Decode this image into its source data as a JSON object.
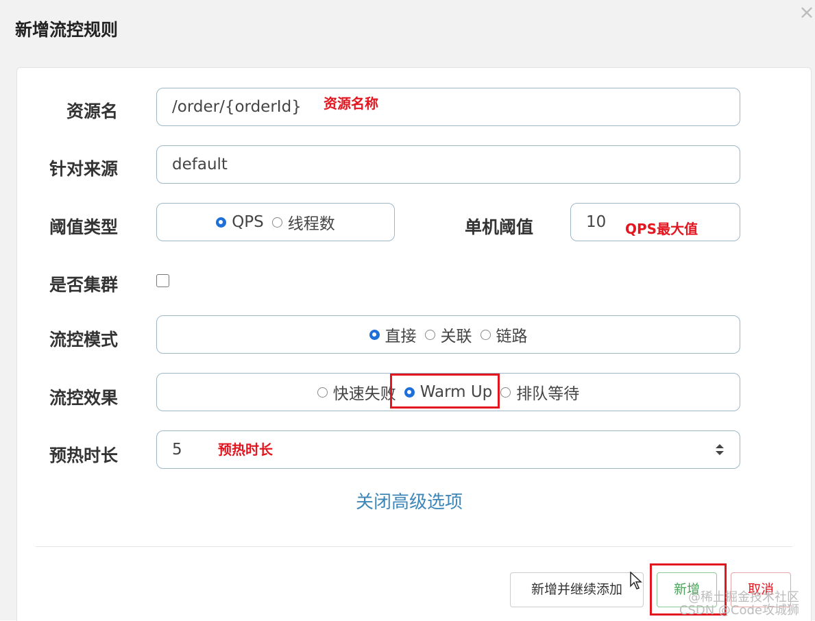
{
  "dialog": {
    "title": "新增流控规则",
    "close_label": "×"
  },
  "form": {
    "resource": {
      "label": "资源名",
      "value": "/order/{orderId}",
      "annotation": "资源名称"
    },
    "limit_app": {
      "label": "针对来源",
      "value": "default"
    },
    "grade": {
      "label": "阈值类型",
      "options": [
        {
          "label": "QPS",
          "checked": true
        },
        {
          "label": "线程数",
          "checked": false
        }
      ]
    },
    "threshold": {
      "label": "单机阈值",
      "value": "10",
      "annotation": "QPS最大值"
    },
    "cluster": {
      "label": "是否集群",
      "checked": false
    },
    "strategy": {
      "label": "流控模式",
      "options": [
        {
          "label": "直接",
          "checked": true
        },
        {
          "label": "关联",
          "checked": false
        },
        {
          "label": "链路",
          "checked": false
        }
      ]
    },
    "control_behavior": {
      "label": "流控效果",
      "options": [
        {
          "label": "快速失败",
          "checked": false
        },
        {
          "label": "Warm Up",
          "checked": true
        },
        {
          "label": "排队等待",
          "checked": false
        }
      ]
    },
    "warmup": {
      "label": "预热时长",
      "value": "5",
      "annotation": "预热时长"
    },
    "advanced_toggle": "关闭高级选项"
  },
  "footer": {
    "add_continue": "新增并继续添加",
    "add": "新增",
    "cancel": "取消"
  },
  "watermark": {
    "line1": "@稀土掘金技术社区",
    "line2": "CSDN @Code攻城狮"
  },
  "colors": {
    "accent_blue": "#1e6fd9",
    "annotation_red": "#e3161f",
    "link_blue": "#3d86b8",
    "add_green": "#4ba25a"
  }
}
